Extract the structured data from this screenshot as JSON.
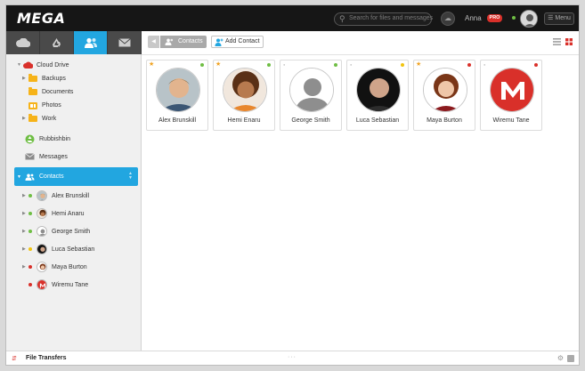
{
  "app": {
    "logo": "MEGA"
  },
  "topbar": {
    "search_placeholder": "Search for files and messages",
    "username": "Anna",
    "badge": "PRO",
    "menu_label": "Menu"
  },
  "sidebar": {
    "tabs": [
      {
        "icon": "cloud-icon",
        "active": false
      },
      {
        "icon": "rubbish-bin-icon",
        "active": false
      },
      {
        "icon": "contacts-icon",
        "active": true
      },
      {
        "icon": "messages-icon",
        "active": false
      }
    ],
    "cloud_drive": "Cloud Drive",
    "folders": [
      "Backups",
      "Documents",
      "Photos",
      "Work"
    ],
    "rubbish_bin": "Rubbishbin",
    "messages": "Messages",
    "contacts": "Contacts",
    "contact_list": [
      {
        "name": "Alex Brunskill",
        "status": "#6fbe44"
      },
      {
        "name": "Hemi Anaru",
        "status": "#6fbe44"
      },
      {
        "name": "George Smith",
        "status": "#6fbe44"
      },
      {
        "name": "Luca Sebastian",
        "status": "#f1c40f"
      },
      {
        "name": "Maya Burton",
        "status": "#d9302a"
      },
      {
        "name": "Wiremu Tane",
        "status": "#d9302a"
      }
    ]
  },
  "toolbar": {
    "breadcrumb": "Contacts",
    "add_contact": "Add Contact"
  },
  "cards": [
    {
      "name": "Alex Brunskill",
      "starred": true,
      "status": "#6fbe44"
    },
    {
      "name": "Hemi Enaru",
      "starred": true,
      "status": "#6fbe44"
    },
    {
      "name": "George Smith",
      "starred": false,
      "status": "#6fbe44"
    },
    {
      "name": "Luca Sebastian",
      "starred": false,
      "status": "#f1c40f"
    },
    {
      "name": "Maya Burton",
      "starred": true,
      "status": "#d9302a"
    },
    {
      "name": "Wiremu Tane",
      "starred": false,
      "status": "#d9302a"
    }
  ],
  "bottombar": {
    "label": "File Transfers"
  },
  "colors": {
    "accent": "#22a6e0",
    "brand_red": "#d9302a",
    "online": "#6fbe44",
    "away": "#f1c40f",
    "star": "#f0a323"
  }
}
